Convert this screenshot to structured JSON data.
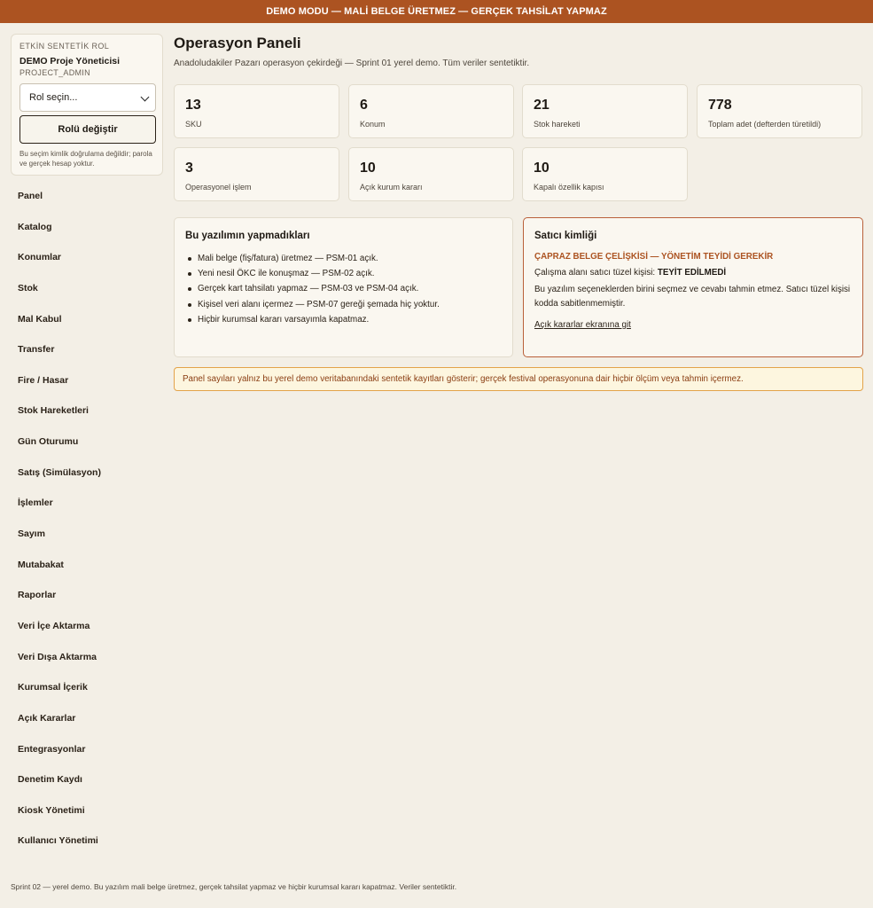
{
  "banner": {
    "text": "DEMO MODU — MALİ BELGE ÜRETMEZ — GERÇEK TAHSİLAT YAPMAZ"
  },
  "role_panel": {
    "kicker": "ETKİN SENTETİK ROL",
    "role_name": "DEMO Proje Yöneticisi",
    "role_code": "PROJECT_ADMIN",
    "select_value": "Rol seçin...",
    "button_label": "Rolü değiştir",
    "note": "Bu seçim kimlik doğrulama değildir; parola ve gerçek hesap yoktur."
  },
  "nav": {
    "items": [
      {
        "label": "Panel"
      },
      {
        "label": "Katalog"
      },
      {
        "label": "Konumlar"
      },
      {
        "label": "Stok"
      },
      {
        "label": "Mal Kabul"
      },
      {
        "label": "Transfer"
      },
      {
        "label": "Fire / Hasar"
      },
      {
        "label": "Stok Hareketleri"
      },
      {
        "label": "Gün Oturumu"
      },
      {
        "label": "Satış (Simülasyon)"
      },
      {
        "label": "İşlemler"
      },
      {
        "label": "Sayım"
      },
      {
        "label": "Mutabakat"
      },
      {
        "label": "Raporlar"
      },
      {
        "label": "Veri İçe Aktarma"
      },
      {
        "label": "Veri Dışa Aktarma"
      },
      {
        "label": "Kurumsal İçerik"
      },
      {
        "label": "Açık Kararlar"
      },
      {
        "label": "Entegrasyonlar"
      },
      {
        "label": "Denetim Kaydı"
      },
      {
        "label": "Kiosk Yönetimi"
      },
      {
        "label": "Kullanıcı Yönetimi"
      }
    ]
  },
  "main": {
    "title": "Operasyon Paneli",
    "subtitle": "Anadoludakiler Pazarı operasyon çekirdeği — Sprint 01 yerel demo. Tüm veriler sentetiktir."
  },
  "stats": [
    {
      "value": "13",
      "label": "SKU"
    },
    {
      "value": "6",
      "label": "Konum"
    },
    {
      "value": "21",
      "label": "Stok hareketi"
    },
    {
      "value": "778",
      "label": "Toplam adet (defterden türetildi)"
    },
    {
      "value": "3",
      "label": "Operasyonel işlem"
    },
    {
      "value": "10",
      "label": "Açık kurum kararı"
    },
    {
      "value": "10",
      "label": "Kapalı özellik kapısı"
    }
  ],
  "not_doing": {
    "title": "Bu yazılımın yapmadıkları",
    "items": [
      "Mali belge (fiş/fatura) üretmez — PSM-01 açık.",
      "Yeni nesil ÖKC ile konuşmaz — PSM-02 açık.",
      "Gerçek kart tahsilatı yapmaz — PSM-03 ve PSM-04 açık.",
      "Kişisel veri alanı içermez — PSM-07 gereği şemada hiç yoktur.",
      "Hiçbir kurumsal kararı varsayımla kapatmaz."
    ]
  },
  "seller": {
    "title": "Satıcı kimliği",
    "warning": "ÇAPRAZ BELGE ÇELİŞKİSİ — YÖNETİM TEYİDİ GEREKİR",
    "line_prefix": "Çalışma alanı satıcı tüzel kişisi:",
    "line_value": "TEYİT EDİLMEDİ",
    "body": "Bu yazılım seçeneklerden birini seçmez ve cevabı tahmin etmez. Satıcı tüzel kişisi kodda sabitlenmemiştir.",
    "link": "Açık kararlar ekranına git"
  },
  "notice": {
    "text": "Panel sayıları yalnız bu yerel demo veritabanındaki sentetik kayıtları gösterir; gerçek festival operasyonuna dair hiçbir ölçüm veya tahmin içermez."
  },
  "footer": {
    "text": "Sprint 02 — yerel demo. Bu yazılım mali belge üretmez, gerçek tahsilat yapmaz ve hiçbir kurumsal kararı kapatmaz. Veriler sentetiktir."
  }
}
